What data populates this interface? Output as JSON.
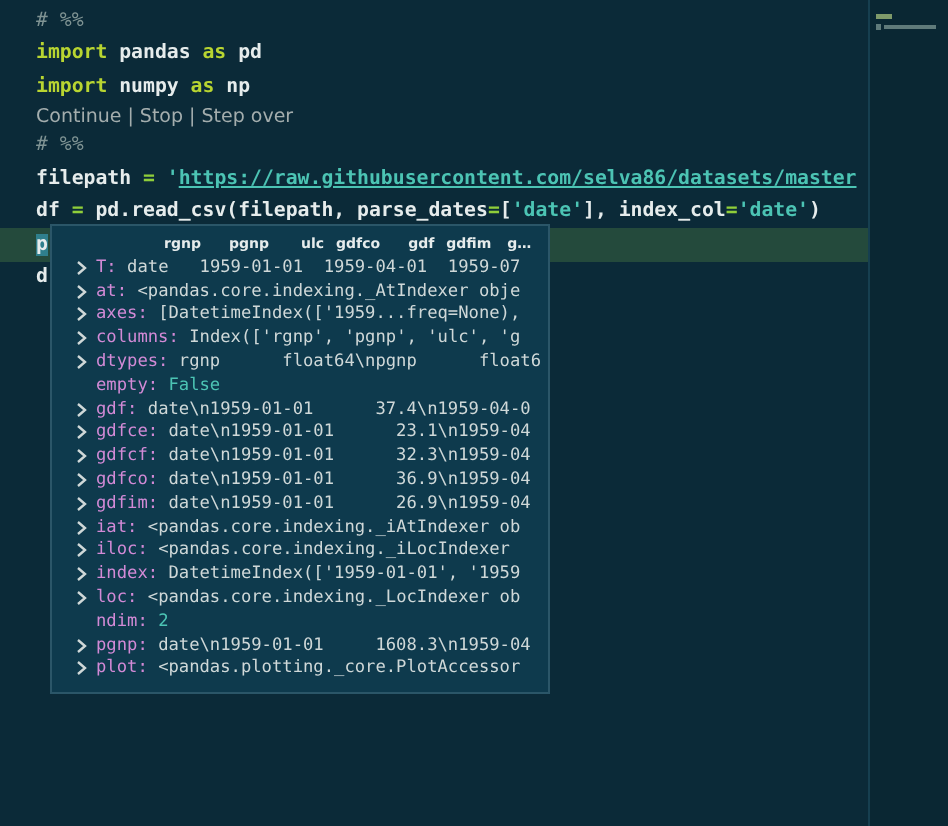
{
  "editor": {
    "lines": [
      {
        "kind": "code",
        "highlighted": false,
        "tokens": [
          {
            "text": "# %%",
            "kind": "comment"
          }
        ]
      },
      {
        "kind": "code",
        "highlighted": false,
        "tokens": [
          {
            "text": "import",
            "kind": "keyword"
          },
          {
            "text": " pandas ",
            "kind": "plain"
          },
          {
            "text": "as",
            "kind": "keyword"
          },
          {
            "text": " pd",
            "kind": "plain"
          }
        ]
      },
      {
        "kind": "code",
        "highlighted": false,
        "tokens": [
          {
            "text": "import",
            "kind": "keyword"
          },
          {
            "text": " numpy ",
            "kind": "plain"
          },
          {
            "text": "as",
            "kind": "keyword"
          },
          {
            "text": " np",
            "kind": "plain"
          }
        ]
      },
      {
        "kind": "codelens",
        "tokens": [
          {
            "text": "Continue",
            "kind": "link"
          },
          {
            "text": "|",
            "kind": "separator"
          },
          {
            "text": "Stop",
            "kind": "link"
          },
          {
            "text": "|",
            "kind": "separator"
          },
          {
            "text": "Step over",
            "kind": "link"
          }
        ]
      },
      {
        "kind": "code",
        "highlighted": false,
        "tokens": [
          {
            "text": "# %%",
            "kind": "comment"
          }
        ]
      },
      {
        "kind": "code",
        "highlighted": false,
        "tokens": [
          {
            "text": "filepath ",
            "kind": "plain"
          },
          {
            "text": "=",
            "kind": "operator"
          },
          {
            "text": " '",
            "kind": "string"
          },
          {
            "text": "https://raw.githubusercontent.com/selva86/datasets/master",
            "kind": "url"
          }
        ]
      },
      {
        "kind": "code",
        "highlighted": false,
        "tokens": [
          {
            "text": "df ",
            "kind": "plain"
          },
          {
            "text": "=",
            "kind": "operator"
          },
          {
            "text": " pd.read_csv(filepath, parse_dates",
            "kind": "plain"
          },
          {
            "text": "=",
            "kind": "operator"
          },
          {
            "text": "[",
            "kind": "plain"
          },
          {
            "text": "'date'",
            "kind": "string"
          },
          {
            "text": "], index_col",
            "kind": "plain"
          },
          {
            "text": "=",
            "kind": "operator"
          },
          {
            "text": "'date'",
            "kind": "string"
          },
          {
            "text": ")",
            "kind": "plain"
          }
        ]
      },
      {
        "kind": "code",
        "highlighted": true,
        "tokens": [
          {
            "text": "p",
            "kind": "match"
          }
        ]
      },
      {
        "kind": "code",
        "highlighted": false,
        "tokens": [
          {
            "text": "d",
            "kind": "plain"
          }
        ]
      }
    ]
  },
  "hover": {
    "header": [
      "rgnp",
      "pgnp",
      "ulc",
      "gdfco",
      "gdf",
      "gdfim",
      "g…"
    ],
    "rows": [
      {
        "name": "T:",
        "value": "date   1959-01-01  1959-04-01  1959-07",
        "expandable": true
      },
      {
        "name": "at:",
        "value": "<pandas.core.indexing._AtIndexer obje",
        "expandable": true
      },
      {
        "name": "axes:",
        "value": "[DatetimeIndex(['1959...freq=None),",
        "expandable": true
      },
      {
        "name": "columns:",
        "value": "Index(['rgnp', 'pgnp', 'ulc', 'g",
        "expandable": true
      },
      {
        "name": "dtypes:",
        "value": "rgnp      float64\\npgnp      float6",
        "expandable": true
      },
      {
        "name": "empty:",
        "value": "False",
        "expandable": false
      },
      {
        "name": "gdf:",
        "value": "date\\n1959-01-01      37.4\\n1959-04-0",
        "expandable": true
      },
      {
        "name": "gdfce:",
        "value": "date\\n1959-01-01      23.1\\n1959-04",
        "expandable": true
      },
      {
        "name": "gdfcf:",
        "value": "date\\n1959-01-01      32.3\\n1959-04",
        "expandable": true
      },
      {
        "name": "gdfco:",
        "value": "date\\n1959-01-01      36.9\\n1959-04",
        "expandable": true
      },
      {
        "name": "gdfim:",
        "value": "date\\n1959-01-01      26.9\\n1959-04",
        "expandable": true
      },
      {
        "name": "iat:",
        "value": "<pandas.core.indexing._iAtIndexer ob",
        "expandable": true
      },
      {
        "name": "iloc:",
        "value": "<pandas.core.indexing._iLocIndexer",
        "expandable": true
      },
      {
        "name": "index:",
        "value": "DatetimeIndex(['1959-01-01', '1959",
        "expandable": true
      },
      {
        "name": "loc:",
        "value": "<pandas.core.indexing._LocIndexer ob",
        "expandable": true
      },
      {
        "name": "ndim:",
        "value": "2",
        "expandable": false
      },
      {
        "name": "pgnp:",
        "value": "date\\n1959-01-01     1608.3\\n1959-04",
        "expandable": true
      },
      {
        "name": "plot:",
        "value": "<pandas.plotting._core.PlotAccessor",
        "expandable": true
      }
    ]
  }
}
